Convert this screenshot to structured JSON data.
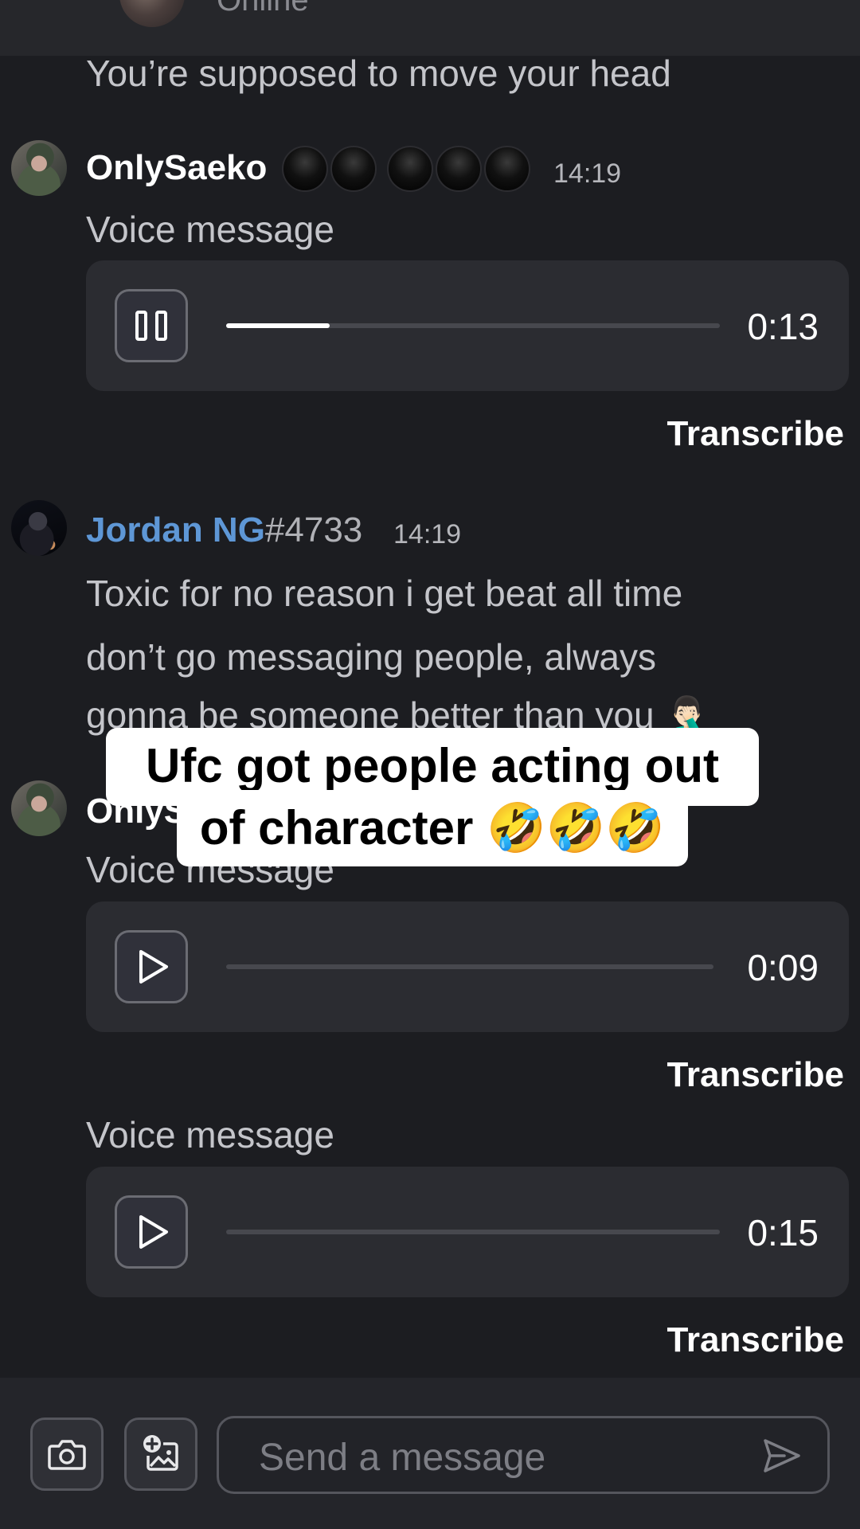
{
  "header": {
    "status": "Online"
  },
  "messages": [
    {
      "text": "You’re supposed to move your head"
    },
    {
      "author": "OnlySaeko",
      "time": "14:19",
      "label": "Voice message",
      "voice": {
        "duration": "0:13",
        "progress": 0.21,
        "state": "playing"
      },
      "transcribe": "Transcribe"
    },
    {
      "author": "Jordan NG",
      "discriminator": "#4733",
      "time": "14:19",
      "lines": [
        "Toxic for no reason i get beat all time",
        "don’t go messaging people, always",
        "gonna be someone better than you 🤦🏻‍♂️"
      ]
    },
    {
      "author": "OnlySaeko",
      "label": "Voice message",
      "voice": {
        "duration": "0:09",
        "progress": 0,
        "state": "paused"
      },
      "transcribe": "Transcribe"
    },
    {
      "label": "Voice message",
      "voice": {
        "duration": "0:15",
        "progress": 0,
        "state": "paused"
      },
      "transcribe": "Transcribe"
    }
  ],
  "caption": {
    "line1": "Ufc got people acting out",
    "line2": "of character 🤣🤣🤣"
  },
  "composer": {
    "placeholder": "Send a message"
  },
  "colors": {
    "background": "#1c1d21",
    "username_blue": "#5e97d6",
    "player_bg": "#2b2c31"
  },
  "icons": [
    "pause-icon",
    "play-icon",
    "camera-icon",
    "add-image-icon",
    "send-icon"
  ]
}
